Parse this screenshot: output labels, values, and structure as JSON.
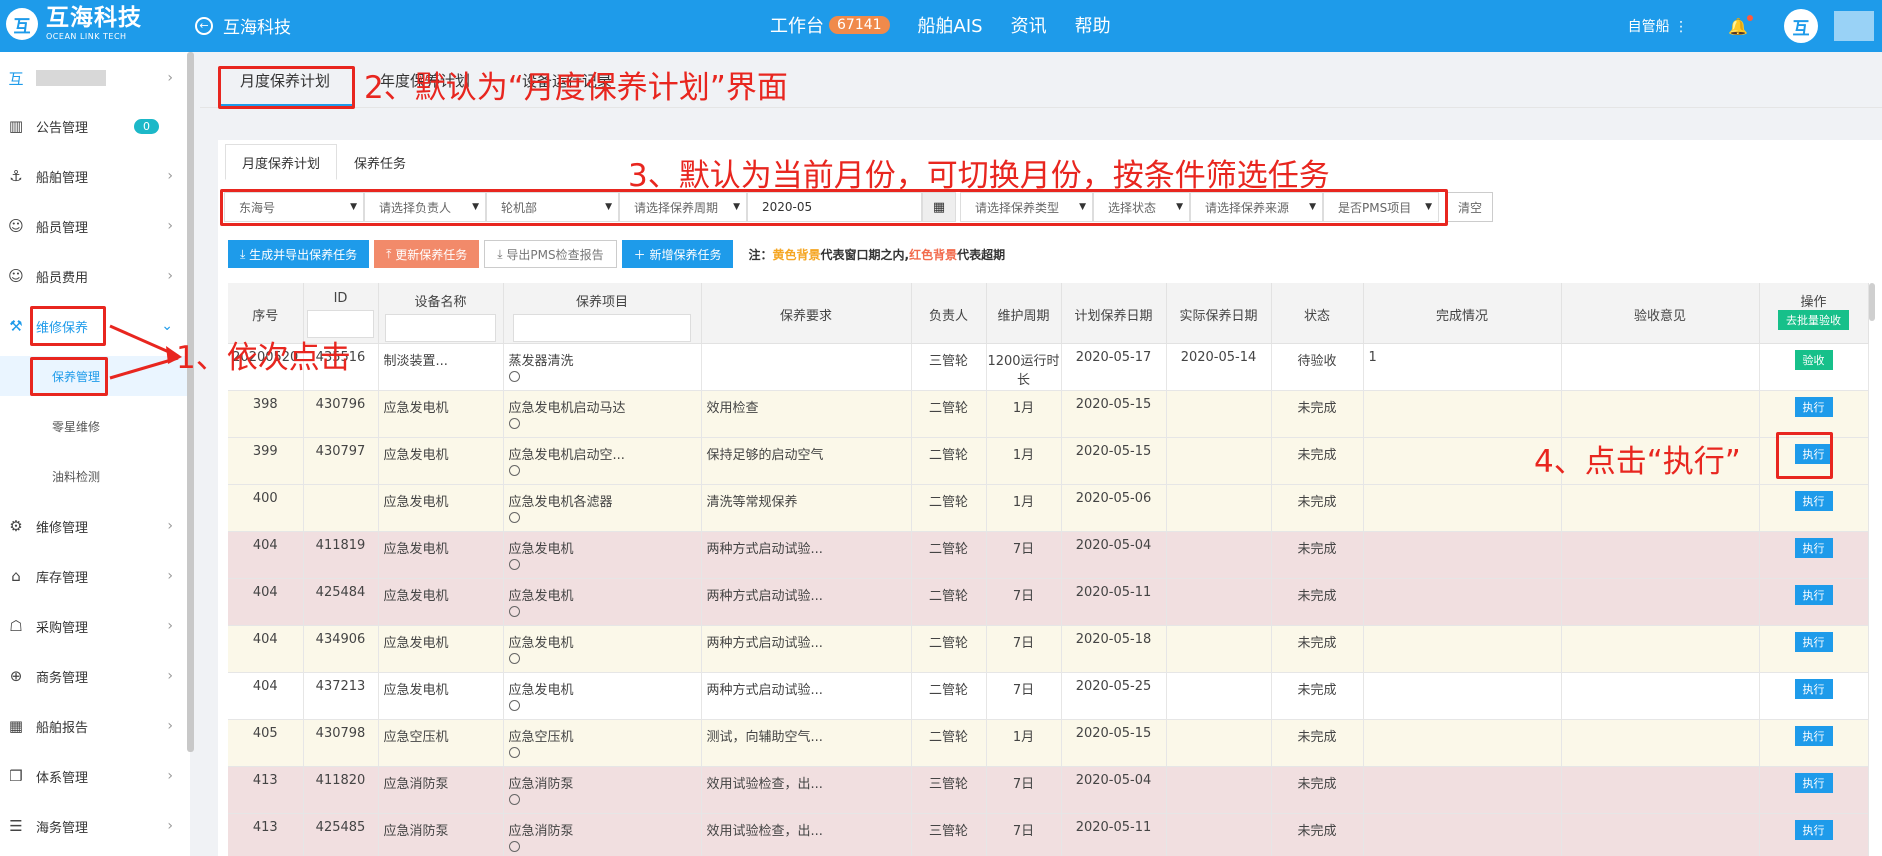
{
  "topbar": {
    "logo_glyph": "互",
    "brand": "互海科技",
    "brand_sub": "OCEAN LINK TECH",
    "back_label": "互海科技",
    "nav": [
      {
        "label": "工作台",
        "badge": "67141"
      },
      {
        "label": "船舶AIS"
      },
      {
        "label": "资讯"
      },
      {
        "label": "帮助"
      }
    ],
    "ship": "自管船",
    "ship_menu_icon": "⋮",
    "bell_icon": "🔔",
    "avatar_glyph": "互"
  },
  "sidebar": {
    "top_logo": "互",
    "items": [
      {
        "label": "公告管理",
        "icon": "▥",
        "badge": "0"
      },
      {
        "label": "船舶管理",
        "icon": "⚓"
      },
      {
        "label": "船员管理",
        "icon": "☺"
      },
      {
        "label": "船员费用",
        "icon": "☺"
      },
      {
        "label": "维修保养",
        "icon": "⚒",
        "expanded": true
      },
      {
        "label": "保养管理"
      },
      {
        "label": "零星维修"
      },
      {
        "label": "油料检测"
      },
      {
        "label": "维修管理",
        "icon": "⚙"
      },
      {
        "label": "库存管理",
        "icon": "⌂"
      },
      {
        "label": "采购管理",
        "icon": "☖"
      },
      {
        "label": "商务管理",
        "icon": "⊕"
      },
      {
        "label": "船舶报告",
        "icon": "▦"
      },
      {
        "label": "体系管理",
        "icon": "❒"
      },
      {
        "label": "海务管理",
        "icon": "☰"
      }
    ]
  },
  "top_tabs": [
    "月度保养计划",
    "年度保养计划",
    "设备运行记录"
  ],
  "inner_tabs": [
    "月度保养计划",
    "保养任务"
  ],
  "filters": {
    "ship": "东海号",
    "owner": "请选择负责人",
    "dept": "轮机部",
    "period": "请选择保养周期",
    "month": "2020-05",
    "type": "请选择保养类型",
    "status": "选择状态",
    "source": "请选择保养来源",
    "pms": "是否PMS项目",
    "clear": "清空"
  },
  "actions": {
    "generate": "生成并导出保养任务",
    "update": "更新保养任务",
    "export_pms": "导出PMS检查报告",
    "add": "新增保养任务",
    "note_prefix": "注：",
    "note_yellow": "黄色背景",
    "note_mid": "代表窗口期之内,",
    "note_red": "红色背景",
    "note_end": "代表超期"
  },
  "table": {
    "headers": [
      "序号",
      "ID",
      "设备名称",
      "保养项目",
      "保养要求",
      "负责人",
      "维护周期",
      "计划保养日期",
      "实际保养日期",
      "状态",
      "完成情况",
      "验收意见",
      "操作"
    ],
    "batch_accept": "去批量验收",
    "rows": [
      {
        "bg": "white",
        "no": "20200520",
        "id": "435516",
        "device": "制淡装置...",
        "item": "蒸发器清洗",
        "req": "",
        "owner": "三管轮",
        "period": "1200运行时长",
        "plan": "2020-05-17",
        "actual": "2020-05-14",
        "status": "待验收",
        "done": "1",
        "opinion": "",
        "op": "验收",
        "op_color": "green"
      },
      {
        "bg": "yellow",
        "no": "398",
        "id": "430796",
        "device": "应急发电机",
        "item": "应急发电机启动马达",
        "req": "效用检查",
        "owner": "二管轮",
        "period": "1月",
        "plan": "2020-05-15",
        "actual": "",
        "status": "未完成",
        "done": "",
        "opinion": "",
        "op": "执行",
        "op_color": "blue"
      },
      {
        "bg": "yellow",
        "no": "399",
        "id": "430797",
        "device": "应急发电机",
        "item": "应急发电机启动空...",
        "req": "保持足够的启动空气",
        "owner": "二管轮",
        "period": "1月",
        "plan": "2020-05-15",
        "actual": "",
        "status": "未完成",
        "done": "",
        "opinion": "",
        "op": "执行",
        "op_color": "blue"
      },
      {
        "bg": "yellow",
        "no": "400",
        "id": "",
        "device": "应急发电机",
        "item": "应急发电机各滤器",
        "req": "清洗等常规保养",
        "owner": "二管轮",
        "period": "1月",
        "plan": "2020-05-06",
        "actual": "",
        "status": "未完成",
        "done": "",
        "opinion": "",
        "op": "执行",
        "op_color": "blue"
      },
      {
        "bg": "red",
        "no": "404",
        "id": "411819",
        "device": "应急发电机",
        "item": "应急发电机",
        "req": "两种方式启动试验...",
        "owner": "二管轮",
        "period": "7日",
        "plan": "2020-05-04",
        "actual": "",
        "status": "未完成",
        "done": "",
        "opinion": "",
        "op": "执行",
        "op_color": "blue"
      },
      {
        "bg": "red",
        "no": "404",
        "id": "425484",
        "device": "应急发电机",
        "item": "应急发电机",
        "req": "两种方式启动试验...",
        "owner": "二管轮",
        "period": "7日",
        "plan": "2020-05-11",
        "actual": "",
        "status": "未完成",
        "done": "",
        "opinion": "",
        "op": "执行",
        "op_color": "blue"
      },
      {
        "bg": "yellow",
        "no": "404",
        "id": "434906",
        "device": "应急发电机",
        "item": "应急发电机",
        "req": "两种方式启动试验...",
        "owner": "二管轮",
        "period": "7日",
        "plan": "2020-05-18",
        "actual": "",
        "status": "未完成",
        "done": "",
        "opinion": "",
        "op": "执行",
        "op_color": "blue"
      },
      {
        "bg": "white",
        "no": "404",
        "id": "437213",
        "device": "应急发电机",
        "item": "应急发电机",
        "req": "两种方式启动试验...",
        "owner": "二管轮",
        "period": "7日",
        "plan": "2020-05-25",
        "actual": "",
        "status": "未完成",
        "done": "",
        "opinion": "",
        "op": "执行",
        "op_color": "blue"
      },
      {
        "bg": "yellow",
        "no": "405",
        "id": "430798",
        "device": "应急空压机",
        "item": "应急空压机",
        "req": "测试，向辅助空气...",
        "owner": "二管轮",
        "period": "1月",
        "plan": "2020-05-15",
        "actual": "",
        "status": "未完成",
        "done": "",
        "opinion": "",
        "op": "执行",
        "op_color": "blue"
      },
      {
        "bg": "red",
        "no": "413",
        "id": "411820",
        "device": "应急消防泵",
        "item": "应急消防泵",
        "req": "效用试验检查，出...",
        "owner": "三管轮",
        "period": "7日",
        "plan": "2020-05-04",
        "actual": "",
        "status": "未完成",
        "done": "",
        "opinion": "",
        "op": "执行",
        "op_color": "blue"
      },
      {
        "bg": "red",
        "no": "413",
        "id": "425485",
        "device": "应急消防泵",
        "item": "应急消防泵",
        "req": "效用试验检查，出...",
        "owner": "三管轮",
        "period": "7日",
        "plan": "2020-05-11",
        "actual": "",
        "status": "未完成",
        "done": "",
        "opinion": "",
        "op": "执行",
        "op_color": "blue"
      }
    ]
  },
  "annotations": {
    "step1": "1、依次点击",
    "step2": "2、默认为“月度保养计划”界面",
    "step3": "3、默认为当前月份，可切换月份，按条件筛选任务",
    "step4": "4、点击“执行”",
    "color": "#e8261f"
  }
}
